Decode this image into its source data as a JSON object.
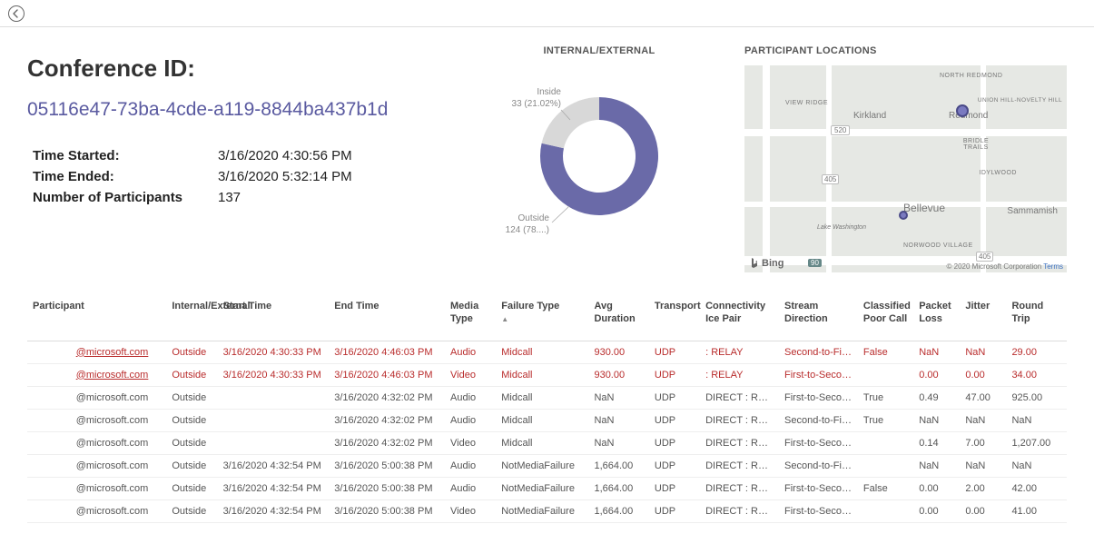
{
  "header": {
    "back_icon": "back-arrow"
  },
  "summary": {
    "title_label": "Conference ID:",
    "conference_id": "05116e47-73ba-4cde-a119-8844ba437b1d",
    "time_started_label": "Time Started:",
    "time_started": "3/16/2020 4:30:56 PM",
    "time_ended_label": "Time Ended:",
    "time_ended": "3/16/2020 5:32:14 PM",
    "participants_label": "Number of Participants",
    "participants": "137"
  },
  "donut": {
    "title": "INTERNAL/EXTERNAL",
    "inside_label_line1": "Inside",
    "inside_label_line2": "33 (21.02%)",
    "outside_label_line1": "Outside",
    "outside_label_line2": "124 (78....)"
  },
  "map": {
    "title": "PARTICIPANT LOCATIONS",
    "logo_text": "Bing",
    "credit_text": "© 2020 Microsoft Corporation",
    "credit_link": "Terms",
    "cities": {
      "kirkland": "Kirkland",
      "redmond": "Redmond",
      "bellevue": "Bellevue",
      "sammamish": "Sammamish",
      "view_ridge": "VIEW RIDGE",
      "lake_wash": "Lake Washington",
      "bridle_trails": "BRIDLE TRAILS",
      "idylwood": "IDYLWOOD",
      "north_redmond": "NORTH REDMOND",
      "union_hill": "UNION HILL-NOVELTY HILL",
      "norwood": "NORWOOD VILLAGE",
      "hwy_520": "520",
      "hwy_405a": "405",
      "hwy_405b": "405",
      "hwy_90": "90"
    }
  },
  "chart_data": {
    "type": "pie",
    "title": "INTERNAL/EXTERNAL",
    "series": [
      {
        "name": "Inside",
        "value": 33,
        "percent": 21.02
      },
      {
        "name": "Outside",
        "value": 124,
        "percent": 78.98
      }
    ]
  },
  "table": {
    "columns": {
      "participant": "Participant",
      "int_ext": "Internal/External",
      "start": "Start Time",
      "end": "End Time",
      "media": "Media Type",
      "failure": "Failure Type",
      "avg_dur": "Avg Duration",
      "transport": "Transport",
      "conn": "Connectivity Ice Pair",
      "stream": "Stream Direction",
      "classified": "Classified Poor Call",
      "packet": "Packet Loss",
      "jitter": "Jitter",
      "rtt": "Round Trip"
    },
    "rows": [
      {
        "hl": true,
        "participant": "@microsoft.com",
        "int_ext": "Outside",
        "start": "3/16/2020 4:30:33 PM",
        "end": "3/16/2020 4:46:03 PM",
        "media": "Audio",
        "failure": "Midcall",
        "avg_dur": "930.00",
        "transport": "UDP",
        "conn": ": RELAY",
        "stream": "Second-to-First",
        "classified": "False",
        "packet": "NaN",
        "jitter": "NaN",
        "rtt": "29.00"
      },
      {
        "hl": true,
        "participant": "@microsoft.com",
        "int_ext": "Outside",
        "start": "3/16/2020 4:30:33 PM",
        "end": "3/16/2020 4:46:03 PM",
        "media": "Video",
        "failure": "Midcall",
        "avg_dur": "930.00",
        "transport": "UDP",
        "conn": ": RELAY",
        "stream": "First-to-Second",
        "classified": "",
        "packet": "0.00",
        "jitter": "0.00",
        "rtt": "34.00"
      },
      {
        "hl": false,
        "participant": "@microsoft.com",
        "int_ext": "Outside",
        "start": "",
        "end": "3/16/2020 4:32:02 PM",
        "media": "Audio",
        "failure": "Midcall",
        "avg_dur": "NaN",
        "transport": "UDP",
        "conn": "DIRECT : RELAY",
        "stream": "First-to-Second",
        "classified": "True",
        "packet": "0.49",
        "jitter": "47.00",
        "rtt": "925.00"
      },
      {
        "hl": false,
        "participant": "@microsoft.com",
        "int_ext": "Outside",
        "start": "",
        "end": "3/16/2020 4:32:02 PM",
        "media": "Audio",
        "failure": "Midcall",
        "avg_dur": "NaN",
        "transport": "UDP",
        "conn": "DIRECT : RELAY",
        "stream": "Second-to-First",
        "classified": "True",
        "packet": "NaN",
        "jitter": "NaN",
        "rtt": "NaN"
      },
      {
        "hl": false,
        "participant": "@microsoft.com",
        "int_ext": "Outside",
        "start": "",
        "end": "3/16/2020 4:32:02 PM",
        "media": "Video",
        "failure": "Midcall",
        "avg_dur": "NaN",
        "transport": "UDP",
        "conn": "DIRECT : RELAY",
        "stream": "First-to-Second",
        "classified": "",
        "packet": "0.14",
        "jitter": "7.00",
        "rtt": "1,207.00"
      },
      {
        "hl": false,
        "participant": "@microsoft.com",
        "int_ext": "Outside",
        "start": "3/16/2020 4:32:54 PM",
        "end": "3/16/2020 5:00:38 PM",
        "media": "Audio",
        "failure": "NotMediaFailure",
        "avg_dur": "1,664.00",
        "transport": "UDP",
        "conn": "DIRECT : RELAY",
        "stream": "Second-to-First",
        "classified": "",
        "packet": "NaN",
        "jitter": "NaN",
        "rtt": "NaN"
      },
      {
        "hl": false,
        "participant": "@microsoft.com",
        "int_ext": "Outside",
        "start": "3/16/2020 4:32:54 PM",
        "end": "3/16/2020 5:00:38 PM",
        "media": "Audio",
        "failure": "NotMediaFailure",
        "avg_dur": "1,664.00",
        "transport": "UDP",
        "conn": "DIRECT : RELAY",
        "stream": "First-to-Second",
        "classified": "False",
        "packet": "0.00",
        "jitter": "2.00",
        "rtt": "42.00"
      },
      {
        "hl": false,
        "participant": "@microsoft.com",
        "int_ext": "Outside",
        "start": "3/16/2020 4:32:54 PM",
        "end": "3/16/2020 5:00:38 PM",
        "media": "Video",
        "failure": "NotMediaFailure",
        "avg_dur": "1,664.00",
        "transport": "UDP",
        "conn": "DIRECT : RELAY",
        "stream": "First-to-Second",
        "classified": "",
        "packet": "0.00",
        "jitter": "0.00",
        "rtt": "41.00"
      }
    ]
  }
}
